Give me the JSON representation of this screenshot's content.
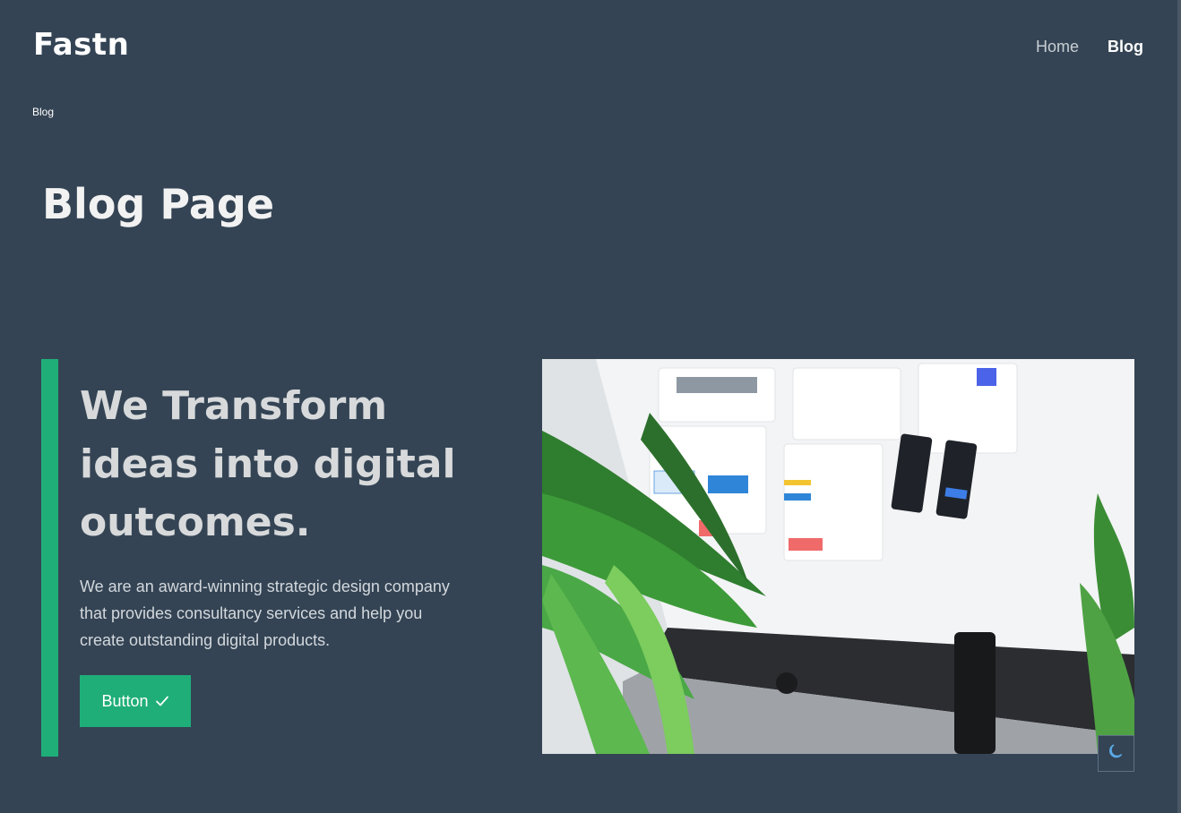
{
  "header": {
    "logo": "Fastn",
    "nav": [
      {
        "label": "Home",
        "active": false
      },
      {
        "label": "Blog",
        "active": true
      }
    ]
  },
  "breadcrumb": "Blog",
  "page_title": "Blog Page",
  "hero": {
    "heading": "We Transform ideas into digital outcomes.",
    "text": "We are an award-winning strategic design company that provides consultancy services and help you create outstanding digital products.",
    "button_label": "Button",
    "button_icon": "check-icon",
    "image_icon": "desk-monitor-plants-photo"
  },
  "theme_toggle_icon": "moon-icon",
  "colors": {
    "background": "#344454",
    "accent": "#1fae78",
    "toggle_icon": "#5aa9e6"
  }
}
